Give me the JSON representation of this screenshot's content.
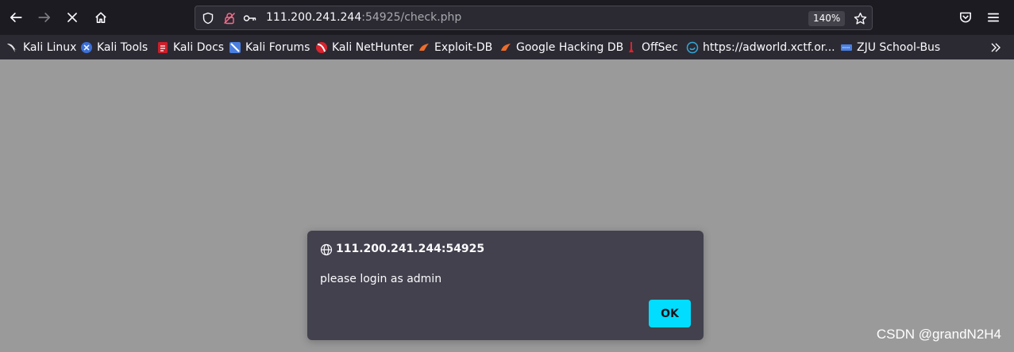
{
  "urlbar": {
    "host": "111.200.241.244",
    "path": ":54925/check.php",
    "zoom": "140%"
  },
  "bookmarks": [
    {
      "label": "Kali Linux",
      "icon": "kali-dragon-icon"
    },
    {
      "label": "Kali Tools",
      "icon": "kali-tools-icon"
    },
    {
      "label": "Kali Docs",
      "icon": "kali-docs-icon"
    },
    {
      "label": "Kali Forums",
      "icon": "kali-forums-icon"
    },
    {
      "label": "Kali NetHunter",
      "icon": "kali-nethunter-icon"
    },
    {
      "label": "Exploit-DB",
      "icon": "exploit-db-icon"
    },
    {
      "label": "Google Hacking DB",
      "icon": "google-hacking-db-icon"
    },
    {
      "label": "OffSec",
      "icon": "offsec-icon"
    },
    {
      "label": "https://adworld.xctf.or...",
      "icon": "adworld-icon"
    },
    {
      "label": "ZJU School-Bus",
      "icon": "zju-icon"
    }
  ],
  "dialog": {
    "title": "111.200.241.244:54925",
    "message": "please login as admin",
    "ok_label": "OK"
  },
  "watermark": "CSDN @grandN2H4"
}
